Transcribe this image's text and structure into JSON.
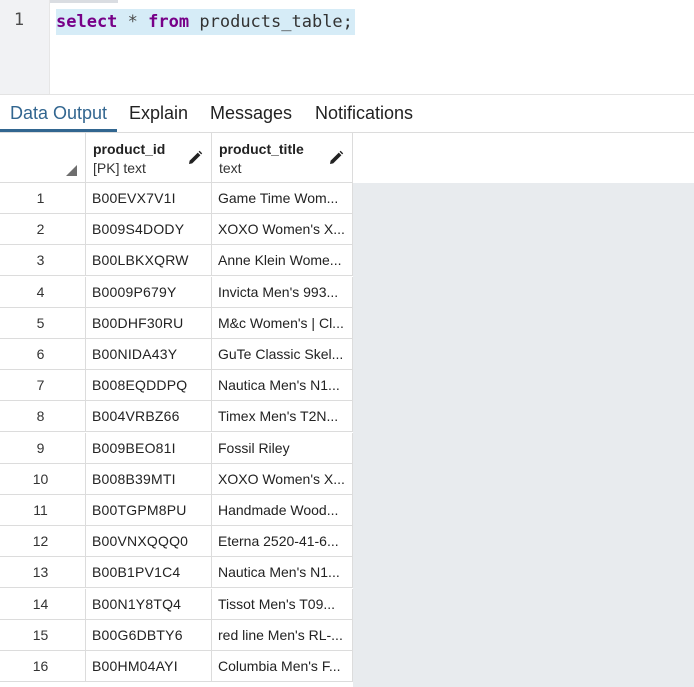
{
  "editor": {
    "line_number": "1",
    "tokens": {
      "kw_select": "select",
      "star": "*",
      "kw_from": "from",
      "table": "products_table;"
    }
  },
  "tabs": [
    {
      "label": "Data Output",
      "active": true
    },
    {
      "label": "Explain",
      "active": false
    },
    {
      "label": "Messages",
      "active": false
    },
    {
      "label": "Notifications",
      "active": false
    }
  ],
  "grid": {
    "columns": [
      {
        "name": "product_id",
        "type": "[PK] text"
      },
      {
        "name": "product_title",
        "type": "text"
      }
    ],
    "rows": [
      {
        "num": "1",
        "product_id": "B00EVX7V1I",
        "product_title": "Game Time Wom..."
      },
      {
        "num": "2",
        "product_id": "B009S4DODY",
        "product_title": "XOXO Women's X..."
      },
      {
        "num": "3",
        "product_id": "B00LBKXQRW",
        "product_title": "Anne Klein Wome..."
      },
      {
        "num": "4",
        "product_id": "B0009P679Y",
        "product_title": "Invicta Men's 993..."
      },
      {
        "num": "5",
        "product_id": "B00DHF30RU",
        "product_title": "M&c Women's | Cl..."
      },
      {
        "num": "6",
        "product_id": "B00NIDA43Y",
        "product_title": "GuTe Classic Skel..."
      },
      {
        "num": "7",
        "product_id": "B008EQDDPQ",
        "product_title": "Nautica Men's N1..."
      },
      {
        "num": "8",
        "product_id": "B004VRBZ66",
        "product_title": "Timex Men's T2N..."
      },
      {
        "num": "9",
        "product_id": "B009BEO81I",
        "product_title": "Fossil Riley"
      },
      {
        "num": "10",
        "product_id": "B008B39MTI",
        "product_title": "XOXO Women's X..."
      },
      {
        "num": "11",
        "product_id": "B00TGPM8PU",
        "product_title": "Handmade Wood..."
      },
      {
        "num": "12",
        "product_id": "B00VNXQQQ0",
        "product_title": "Eterna 2520-41-6..."
      },
      {
        "num": "13",
        "product_id": "B00B1PV1C4",
        "product_title": "Nautica Men's N1..."
      },
      {
        "num": "14",
        "product_id": "B00N1Y8TQ4",
        "product_title": "Tissot Men's T09..."
      },
      {
        "num": "15",
        "product_id": "B00G6DBTY6",
        "product_title": "red line Men's RL-..."
      },
      {
        "num": "16",
        "product_id": "B00HM04AYI",
        "product_title": "Columbia Men's F..."
      }
    ]
  },
  "icons": {
    "edit_column": "pencil-icon",
    "sort_corner": "corner-triangle-icon"
  },
  "colors": {
    "keyword": "#770088",
    "active_tab": "#326690",
    "code_highlight": "#d6ecf7",
    "grid_empty": "#e8ebee"
  }
}
